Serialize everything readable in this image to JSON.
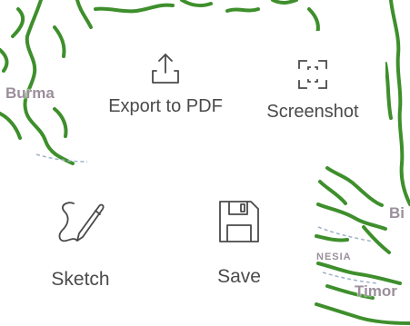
{
  "map": {
    "labels": {
      "burma": "Burma",
      "bi": "Bi",
      "nesia": "NESIA",
      "timor": "Timor"
    }
  },
  "actions": {
    "export_pdf": {
      "label": "Export to PDF",
      "icon": "export-icon"
    },
    "screenshot": {
      "label": "Screenshot",
      "icon": "screenshot-icon"
    },
    "sketch": {
      "label": "Sketch",
      "icon": "sketch-pen-icon"
    },
    "save": {
      "label": "Save",
      "icon": "floppy-disk-icon"
    }
  },
  "colors": {
    "coastline": "#3e8f2c",
    "text": "#4a4a4a",
    "tile_background": "#ffffff"
  }
}
